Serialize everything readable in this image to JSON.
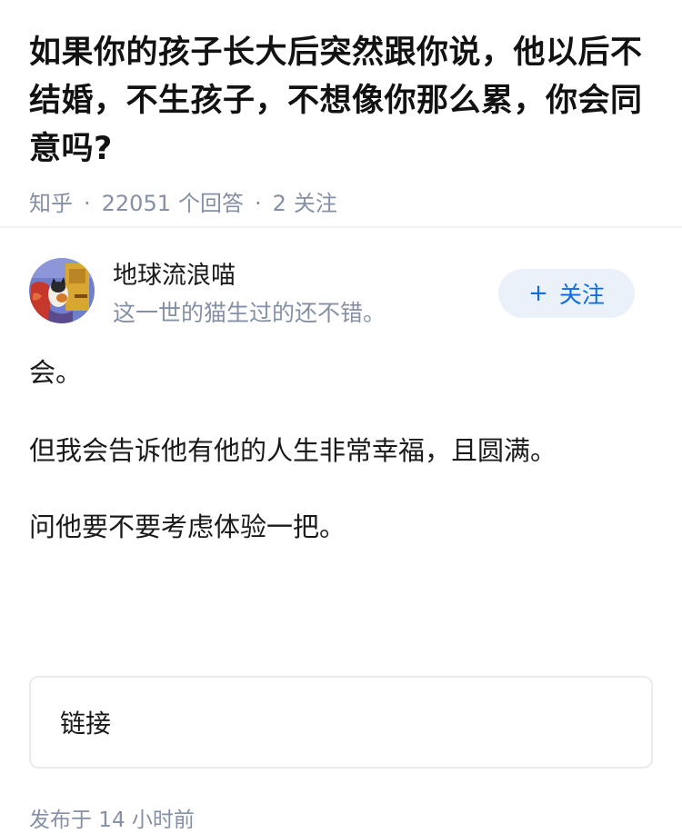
{
  "question": {
    "title": "如果你的孩子长大后突然跟你说，他以后不结婚，不生孩子，不想像你那么累，你会同意吗?",
    "source": "知乎",
    "separator": "·",
    "answers_count": "22051",
    "answers_label": "个回答",
    "follows_count": "2",
    "follows_label": "关注"
  },
  "answer": {
    "author_name": "地球流浪喵",
    "author_bio": "这一世的猫生过的还不错。",
    "follow_button": {
      "plus": "+",
      "label": "关注"
    },
    "paragraphs": [
      "会。",
      "但我会告诉他有他的人生非常幸福，且圆满。",
      "问他要不要考虑体验一把。"
    ],
    "link_card_label": "链接",
    "published": "发布于  14 小时前"
  },
  "colors": {
    "meta_gray": "#8590a6",
    "follow_bg": "#ebf1f9",
    "follow_text": "#0f6ae0"
  }
}
